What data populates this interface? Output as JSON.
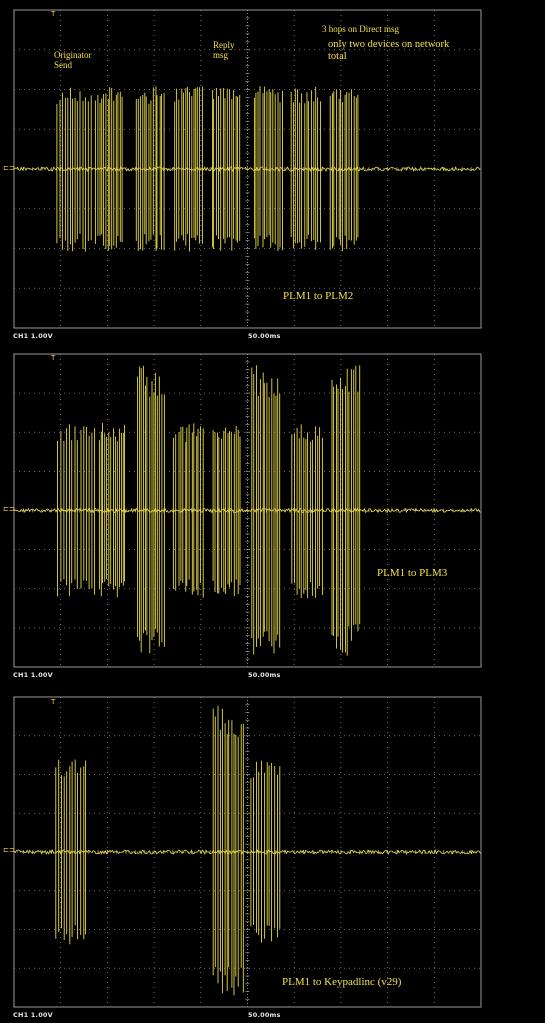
{
  "screens": [
    {
      "title": "PLM1 to PLM2",
      "channel": "CH1 1.00V",
      "timebase": "50.00ms",
      "annotations": {
        "originator": "Originator\nSend",
        "reply": "Reply\nmsg",
        "hops": "3 hops on Direct msg",
        "network": "only two devices on network\ntotal"
      }
    },
    {
      "title": "PLM1 to PLM3",
      "channel": "CH1 1.00V",
      "timebase": "50.00ms"
    },
    {
      "title": "PLM1 to Keypadlinc (v29)",
      "channel": "CH1 1.00V",
      "timebase": "50.00ms"
    }
  ],
  "colors": {
    "trace": "#e6d84a",
    "grid": "#8a8a8a",
    "background": "#000000"
  }
}
